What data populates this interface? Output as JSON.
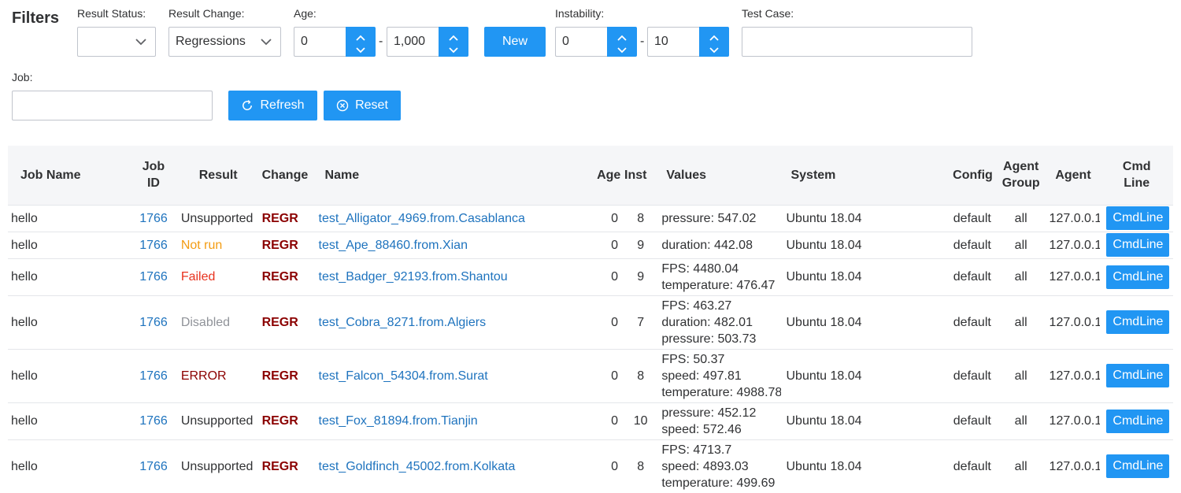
{
  "filters": {
    "title": "Filters",
    "result_status_label": "Result Status:",
    "result_status_value": "",
    "result_change_label": "Result Change:",
    "result_change_value": "Regressions",
    "age_label": "Age:",
    "age_from": "0",
    "age_to": "1,000",
    "age_dash": "-",
    "new_button": "New",
    "instability_label": "Instability:",
    "instability_from": "0",
    "instability_to": "10",
    "instability_dash": "-",
    "test_case_label": "Test Case:",
    "test_case_value": "",
    "job_label": "Job:",
    "job_value": "",
    "refresh_button": "Refresh",
    "reset_button": "Reset"
  },
  "colors": {
    "accent": "#2196f3",
    "link": "#1e73be",
    "regr": "#8b0000",
    "not_run": "#f39c12",
    "failed": "#e8321e",
    "disabled": "#909399",
    "error": "#8b0000"
  },
  "table": {
    "headers": {
      "job_name": "Job Name",
      "job_id_1": "Job",
      "job_id_2": "ID",
      "result": "Result",
      "change": "Change",
      "name": "Name",
      "age": "Age",
      "instability": "Inst",
      "values": "Values",
      "system": "System",
      "config": "Config",
      "agent_group_1": "Agent",
      "agent_group_2": "Group",
      "agent": "Agent",
      "cmd_line_1": "Cmd",
      "cmd_line_2": "Line"
    },
    "rows": [
      {
        "job_name": "hello",
        "job_id": "1766",
        "result": "Unsupported",
        "result_kind": "unsupported",
        "change": "REGR",
        "name": "test_Alligator_4969.from.Casablanca",
        "age": "0",
        "instability": "8",
        "values": [
          "pressure: 547.02"
        ],
        "system": "Ubuntu 18.04",
        "config": "default",
        "agent_group": "all",
        "agent": "127.0.0.1",
        "cmd": "CmdLine"
      },
      {
        "job_name": "hello",
        "job_id": "1766",
        "result": "Not run",
        "result_kind": "not_run",
        "change": "REGR",
        "name": "test_Ape_88460.from.Xian",
        "age": "0",
        "instability": "9",
        "values": [
          "duration: 442.08"
        ],
        "system": "Ubuntu 18.04",
        "config": "default",
        "agent_group": "all",
        "agent": "127.0.0.1",
        "cmd": "CmdLine"
      },
      {
        "job_name": "hello",
        "job_id": "1766",
        "result": "Failed",
        "result_kind": "failed",
        "change": "REGR",
        "name": "test_Badger_92193.from.Shantou",
        "age": "0",
        "instability": "9",
        "values": [
          "FPS: 4480.04",
          "temperature: 476.47"
        ],
        "system": "Ubuntu 18.04",
        "config": "default",
        "agent_group": "all",
        "agent": "127.0.0.1",
        "cmd": "CmdLine"
      },
      {
        "job_name": "hello",
        "job_id": "1766",
        "result": "Disabled",
        "result_kind": "disabled",
        "change": "REGR",
        "name": "test_Cobra_8271.from.Algiers",
        "age": "0",
        "instability": "7",
        "values": [
          "FPS: 463.27",
          "duration: 482.01",
          "pressure: 503.73"
        ],
        "system": "Ubuntu 18.04",
        "config": "default",
        "agent_group": "all",
        "agent": "127.0.0.1",
        "cmd": "CmdLine"
      },
      {
        "job_name": "hello",
        "job_id": "1766",
        "result": "ERROR",
        "result_kind": "error",
        "change": "REGR",
        "name": "test_Falcon_54304.from.Surat",
        "age": "0",
        "instability": "8",
        "values": [
          "FPS: 50.37",
          "speed: 497.81",
          "temperature: 4988.78"
        ],
        "system": "Ubuntu 18.04",
        "config": "default",
        "agent_group": "all",
        "agent": "127.0.0.1",
        "cmd": "CmdLine"
      },
      {
        "job_name": "hello",
        "job_id": "1766",
        "result": "Unsupported",
        "result_kind": "unsupported",
        "change": "REGR",
        "name": "test_Fox_81894.from.Tianjin",
        "age": "0",
        "instability": "10",
        "values": [
          "pressure: 452.12",
          "speed: 572.46"
        ],
        "system": "Ubuntu 18.04",
        "config": "default",
        "agent_group": "all",
        "agent": "127.0.0.1",
        "cmd": "CmdLine"
      },
      {
        "job_name": "hello",
        "job_id": "1766",
        "result": "Unsupported",
        "result_kind": "unsupported",
        "change": "REGR",
        "name": "test_Goldfinch_45002.from.Kolkata",
        "age": "0",
        "instability": "8",
        "values": [
          "FPS: 4713.7",
          "speed: 4893.03",
          "temperature: 499.69"
        ],
        "system": "Ubuntu 18.04",
        "config": "default",
        "agent_group": "all",
        "agent": "127.0.0.1",
        "cmd": "CmdLine"
      }
    ]
  }
}
